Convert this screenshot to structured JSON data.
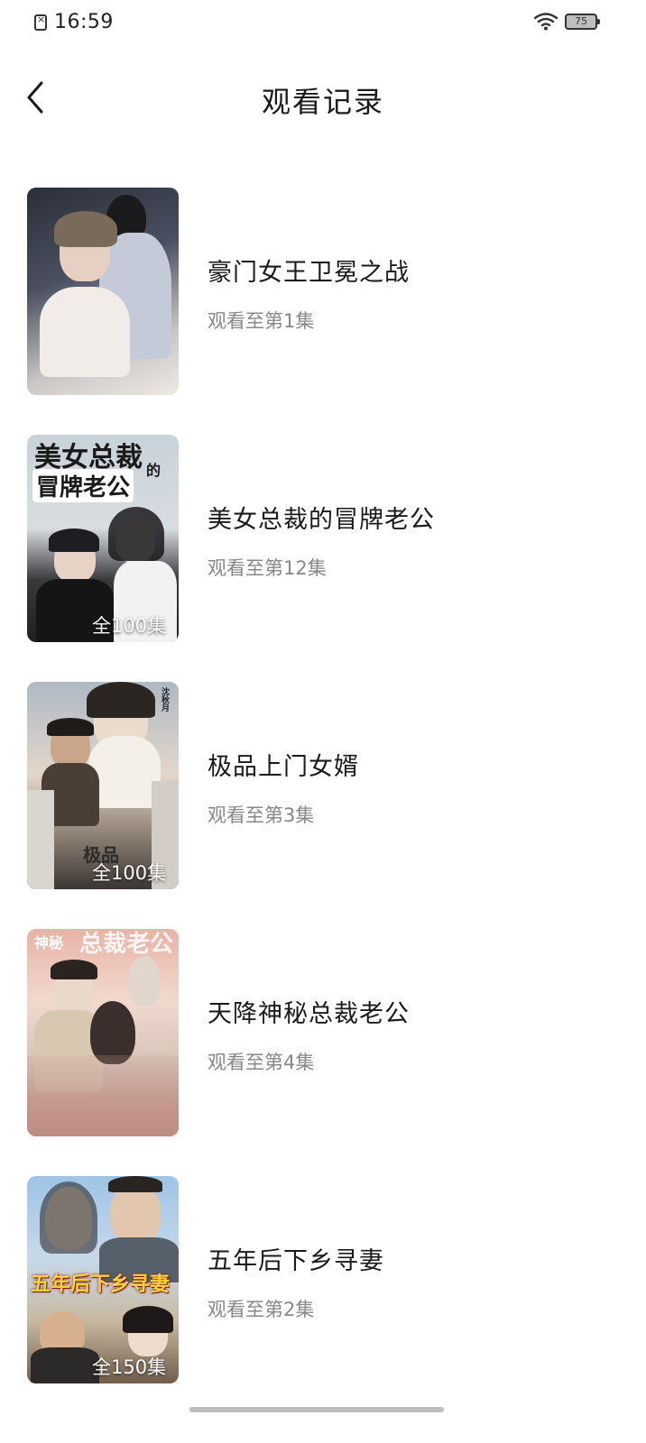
{
  "status_bar": {
    "time": "16:59",
    "battery_level": "75"
  },
  "header": {
    "title": "观看记录",
    "back_icon": "chevron-left-icon"
  },
  "history": [
    {
      "title": "豪门女王卫冕之战",
      "progress": "观看至第1集",
      "badge": ""
    },
    {
      "title": "美女总裁的冒牌老公",
      "progress": "观看至第12集",
      "badge": "全100集",
      "poster_text": [
        "美女总裁",
        "的",
        "冒牌老公"
      ]
    },
    {
      "title": "极品上门女婿",
      "progress": "观看至第3集",
      "badge": "全100集",
      "poster_text": [
        "极品",
        "沈秋月"
      ]
    },
    {
      "title": "天降神秘总裁老公",
      "progress": "观看至第4集",
      "badge": "",
      "poster_text": [
        "神秘",
        "总裁老公"
      ]
    },
    {
      "title": "五年后下乡寻妻",
      "progress": "观看至第2集",
      "badge": "全150集",
      "poster_text": [
        "五年后下乡寻妻"
      ]
    }
  ],
  "colors": {
    "title": "#1a1a1a",
    "secondary": "#888888",
    "background": "#ffffff"
  }
}
